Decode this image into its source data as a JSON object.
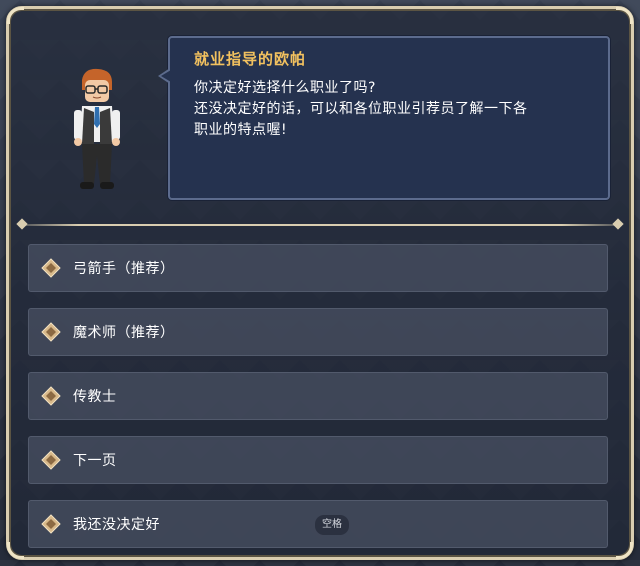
{
  "npc": {
    "name": "就业指导的欧帕",
    "lines": [
      "你决定好选择什么职业了吗?",
      "还没决定好的话，可以和各位职业引荐员了解一下各",
      "职业的特点喔!"
    ]
  },
  "options": [
    {
      "label": "弓箭手（推荐）",
      "icon": "diamond-bullet-icon"
    },
    {
      "label": "魔术师（推荐）",
      "icon": "diamond-bullet-icon"
    },
    {
      "label": "传教士",
      "icon": "diamond-bullet-icon"
    },
    {
      "label": "下一页",
      "icon": "diamond-bullet-icon"
    },
    {
      "label": "我还没决定好",
      "icon": "diamond-bullet-icon",
      "key_hint": "空格"
    }
  ],
  "colors": {
    "npc_name": "#f2c15f",
    "frame_border": "#d9cdb0",
    "speech_bg": "#25324f",
    "option_bg": "#464e60"
  }
}
